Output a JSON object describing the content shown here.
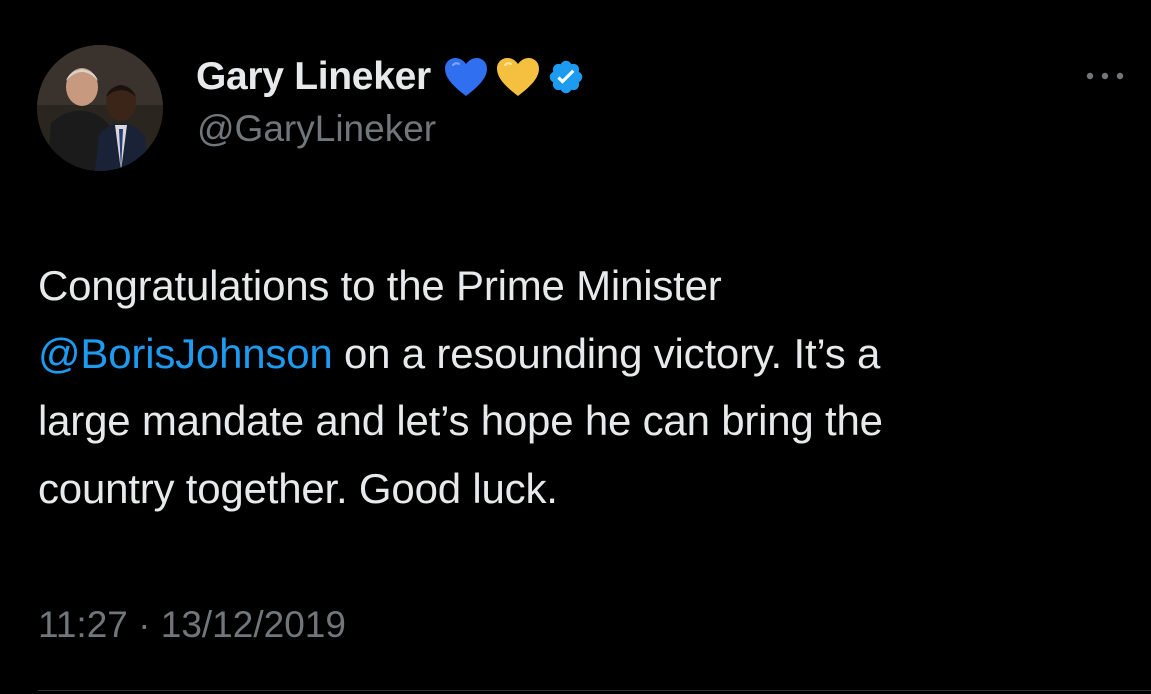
{
  "tweet": {
    "author": {
      "display_name": "Gary Lineker",
      "handle": "@GaryLineker",
      "badges": [
        "blue-heart-icon",
        "yellow-heart-icon",
        "verified-badge-icon"
      ]
    },
    "text": {
      "line1": "Congratulations to the Prime Minister",
      "mention": "@BorisJohnson",
      "line2_rest": " on a resounding victory. It’s a",
      "line3": "large mandate and let’s hope he can bring the",
      "line4": "country together. Good luck."
    },
    "time": "11:27",
    "separator": "·",
    "date": "13/12/2019"
  },
  "colors": {
    "background": "#000000",
    "text_primary": "#e7e9ea",
    "text_secondary": "#71767b",
    "link": "#1d9bf0",
    "heart_blue": "#2f6ff0",
    "heart_yellow": "#f5c040",
    "verified": "#1d9bf0"
  }
}
